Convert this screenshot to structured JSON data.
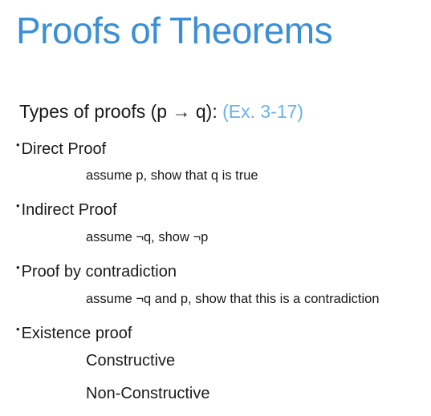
{
  "slide": {
    "title": "Proofs of Theorems",
    "intro": {
      "text": "Types of proofs (p → q): ",
      "reference": "(Ex. 3-17)"
    },
    "bullet_glyph": "•",
    "items": [
      {
        "label": "Direct Proof",
        "detail": "assume p, show that q is true"
      },
      {
        "label": "Indirect Proof",
        "detail": "assume ¬q, show ¬p"
      },
      {
        "label": "Proof by contradiction",
        "detail": "assume ¬q and p, show that this is a contradiction"
      },
      {
        "label": "Existence proof",
        "subitems": [
          "Constructive",
          "Non-Constructive"
        ]
      }
    ],
    "colors": {
      "title": "#3a8fd6",
      "reference": "#67b3ea",
      "text": "#1a1a1a"
    }
  }
}
